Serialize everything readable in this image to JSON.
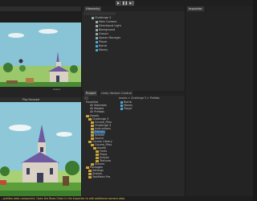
{
  "window": {
    "tabs": {
      "hierarchy": "Hierarchy",
      "inspector": "Inspector",
      "project": "Project",
      "version_control": "Unity Version Control"
    }
  },
  "toolbar": {
    "play_icon": "play-icon",
    "pause_icon": "pause-icon",
    "step_icon": "step-icon"
  },
  "scene_view": {
    "label": "Scene"
  },
  "game_view": {
    "play_mode_label": "Play Focused"
  },
  "hierarchy": {
    "scene_name": "Challenge 3",
    "items": [
      "Main Camera",
      "Directional Light",
      "Background",
      "Ground",
      "Spawn Manager",
      "Player",
      "Bomb",
      "Money"
    ]
  },
  "project": {
    "breadcrumb": [
      "Assets",
      "Challenge 3",
      "Prefabs"
    ],
    "favorites": [
      "Favorites",
      "All Materials",
      "All Models",
      "All Prefabs"
    ],
    "tree": [
      "Assets",
      "Challenge 3",
      "Course_Files",
      "Challenge 3",
      "Instructions",
      "Prefabs",
      "Scripts",
      "Sound",
      "Course Library",
      "Course_Files",
      "Assets",
      "Fonts",
      "Props",
      "Scripts",
      "Textures",
      "Scenes",
      "Packages",
      "Settings",
      "Scenes",
      "TextMesh Pro"
    ],
    "files": [
      "Bomb",
      "Money",
      "Player"
    ]
  },
  "status_bar": {
    "message": "...prefabs data component. Open the Rows Order in the Inspector to edit additional camera data."
  },
  "colors": {
    "sky": "#8ec8d8",
    "church_wall": "#d9d2c4",
    "roof": "#6e5aa0",
    "grass": "#5c9e3a",
    "warning": "#e5c84a"
  }
}
